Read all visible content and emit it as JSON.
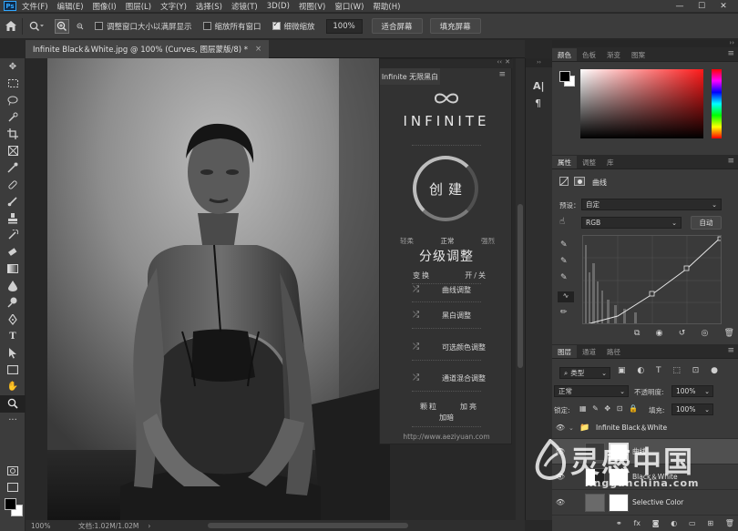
{
  "menubar": {
    "items": [
      "文件(F)",
      "编辑(E)",
      "图像(I)",
      "图层(L)",
      "文字(Y)",
      "选择(S)",
      "滤镜(T)",
      "3D(D)",
      "视图(V)",
      "窗口(W)",
      "帮助(H)"
    ],
    "win_ctrls": [
      "—",
      "☐",
      "✕"
    ]
  },
  "options": {
    "resize_windows": "调整窗口大小以满屏显示",
    "zoom_all_windows": "缩放所有窗口",
    "scrubby_zoom": "细微缩放",
    "zoom_value": "100%",
    "fit_screen": "适合屏幕",
    "fill_screen": "填充屏幕"
  },
  "document": {
    "tab_title": "Infinite Black＆White.jpg @ 100% (Curves, 图层蒙版/8) *",
    "close": "×"
  },
  "infinite": {
    "tab": "Infinite 无限黑白",
    "brand": "INFINITE",
    "create": "创建",
    "levels": [
      "轻柔",
      "正常",
      "强烈"
    ],
    "grade_title": "分级调整",
    "switch_left": "变换",
    "switch_right": "开/关",
    "adjustments": [
      "曲线调整",
      "黑白调整",
      "可选颜色调整",
      "通道混合调整"
    ],
    "grain": "颗粒",
    "brighten": "加亮",
    "deepen": "加暗",
    "url": "http://www.aeziyuan.com"
  },
  "color_panel": {
    "tabs": [
      "颜色",
      "色板",
      "渐变",
      "图案"
    ],
    "accent": "#ff1a1a"
  },
  "properties": {
    "tabs": [
      "属性",
      "调整",
      "库"
    ],
    "title": "曲线",
    "preset_label": "预设：",
    "preset_value": "自定",
    "channel": "RGB",
    "auto": "自动"
  },
  "layers": {
    "tabs": [
      "图层",
      "通道",
      "路径"
    ],
    "filter_kind": "类型",
    "blend_mode": "正常",
    "opacity_label": "不透明度:",
    "opacity_value": "100%",
    "lock_label": "锁定:",
    "fill_label": "填充:",
    "fill_value": "100%",
    "rows": [
      {
        "name": "Infinite Black＆White"
      },
      {
        "name": "曲线"
      },
      {
        "name": "Black＆White"
      },
      {
        "name": "Selective Color"
      }
    ]
  },
  "status": {
    "zoom": "100%",
    "doc": "文档:1.02M/1.02M"
  },
  "watermark": {
    "cn": "灵感中国",
    "en": "lingganchina.com"
  }
}
